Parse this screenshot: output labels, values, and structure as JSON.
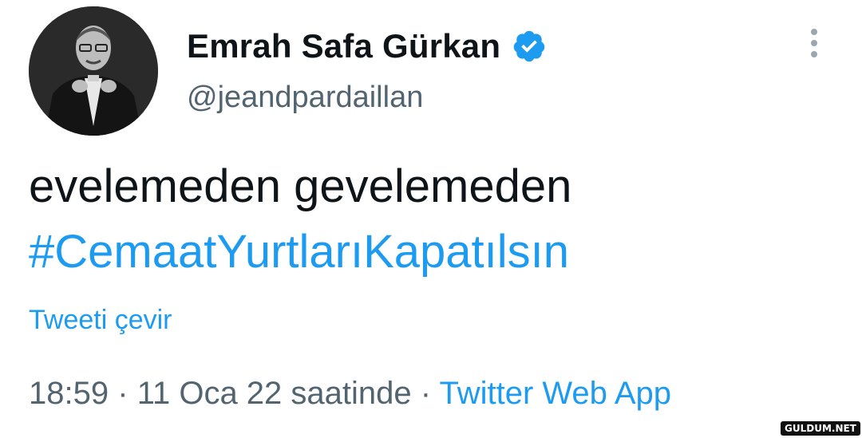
{
  "author": {
    "display_name": "Emrah Safa Gürkan",
    "handle": "@jeandpardaillan",
    "verified": true,
    "avatar_icon": "profile-photo"
  },
  "tweet": {
    "text": "evelemeden gevelemeden",
    "hashtag": "#CemaatYurtlarıKapatılsın",
    "translate_label": "Tweeti çevir"
  },
  "meta": {
    "time": "18:59",
    "separator": "·",
    "date": "11 Oca 22 saatinde",
    "source": "Twitter Web App"
  },
  "watermark": "GULDUM.NET",
  "colors": {
    "accent": "#1d9bf0",
    "text": "#0f1419",
    "secondary": "#536471"
  }
}
